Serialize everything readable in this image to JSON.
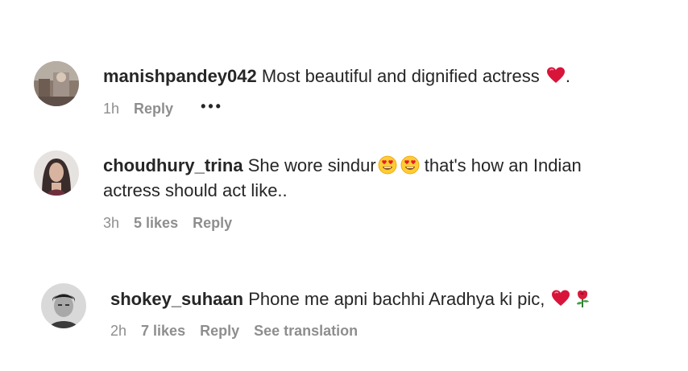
{
  "comments": [
    {
      "username": "manishpandey042",
      "text": " Most beautiful and dignified actress ",
      "text_after_emoji": ".",
      "emoji": "red-heart-icon",
      "time": "1h",
      "reply_label": "Reply",
      "more_label": "•••"
    },
    {
      "username": "choudhury_trina",
      "text": " She wore sindur",
      "text_after_emoji": " that's how an Indian actress should act like..",
      "emoji": "heart-eyes-icon",
      "time": "3h",
      "likes_label": "5 likes",
      "reply_label": "Reply"
    },
    {
      "username": "shokey_suhaan",
      "text": " Phone me apni bachhi Aradhya ki pic, ",
      "emoji": "red-heart-icon",
      "emoji2": "rose-icon",
      "time": "2h",
      "likes_label": "7 likes",
      "reply_label": "Reply",
      "translation_label": "See translation"
    }
  ],
  "colors": {
    "text": "#262626",
    "secondary": "#8e8e8e",
    "heart": "#e0245e"
  }
}
